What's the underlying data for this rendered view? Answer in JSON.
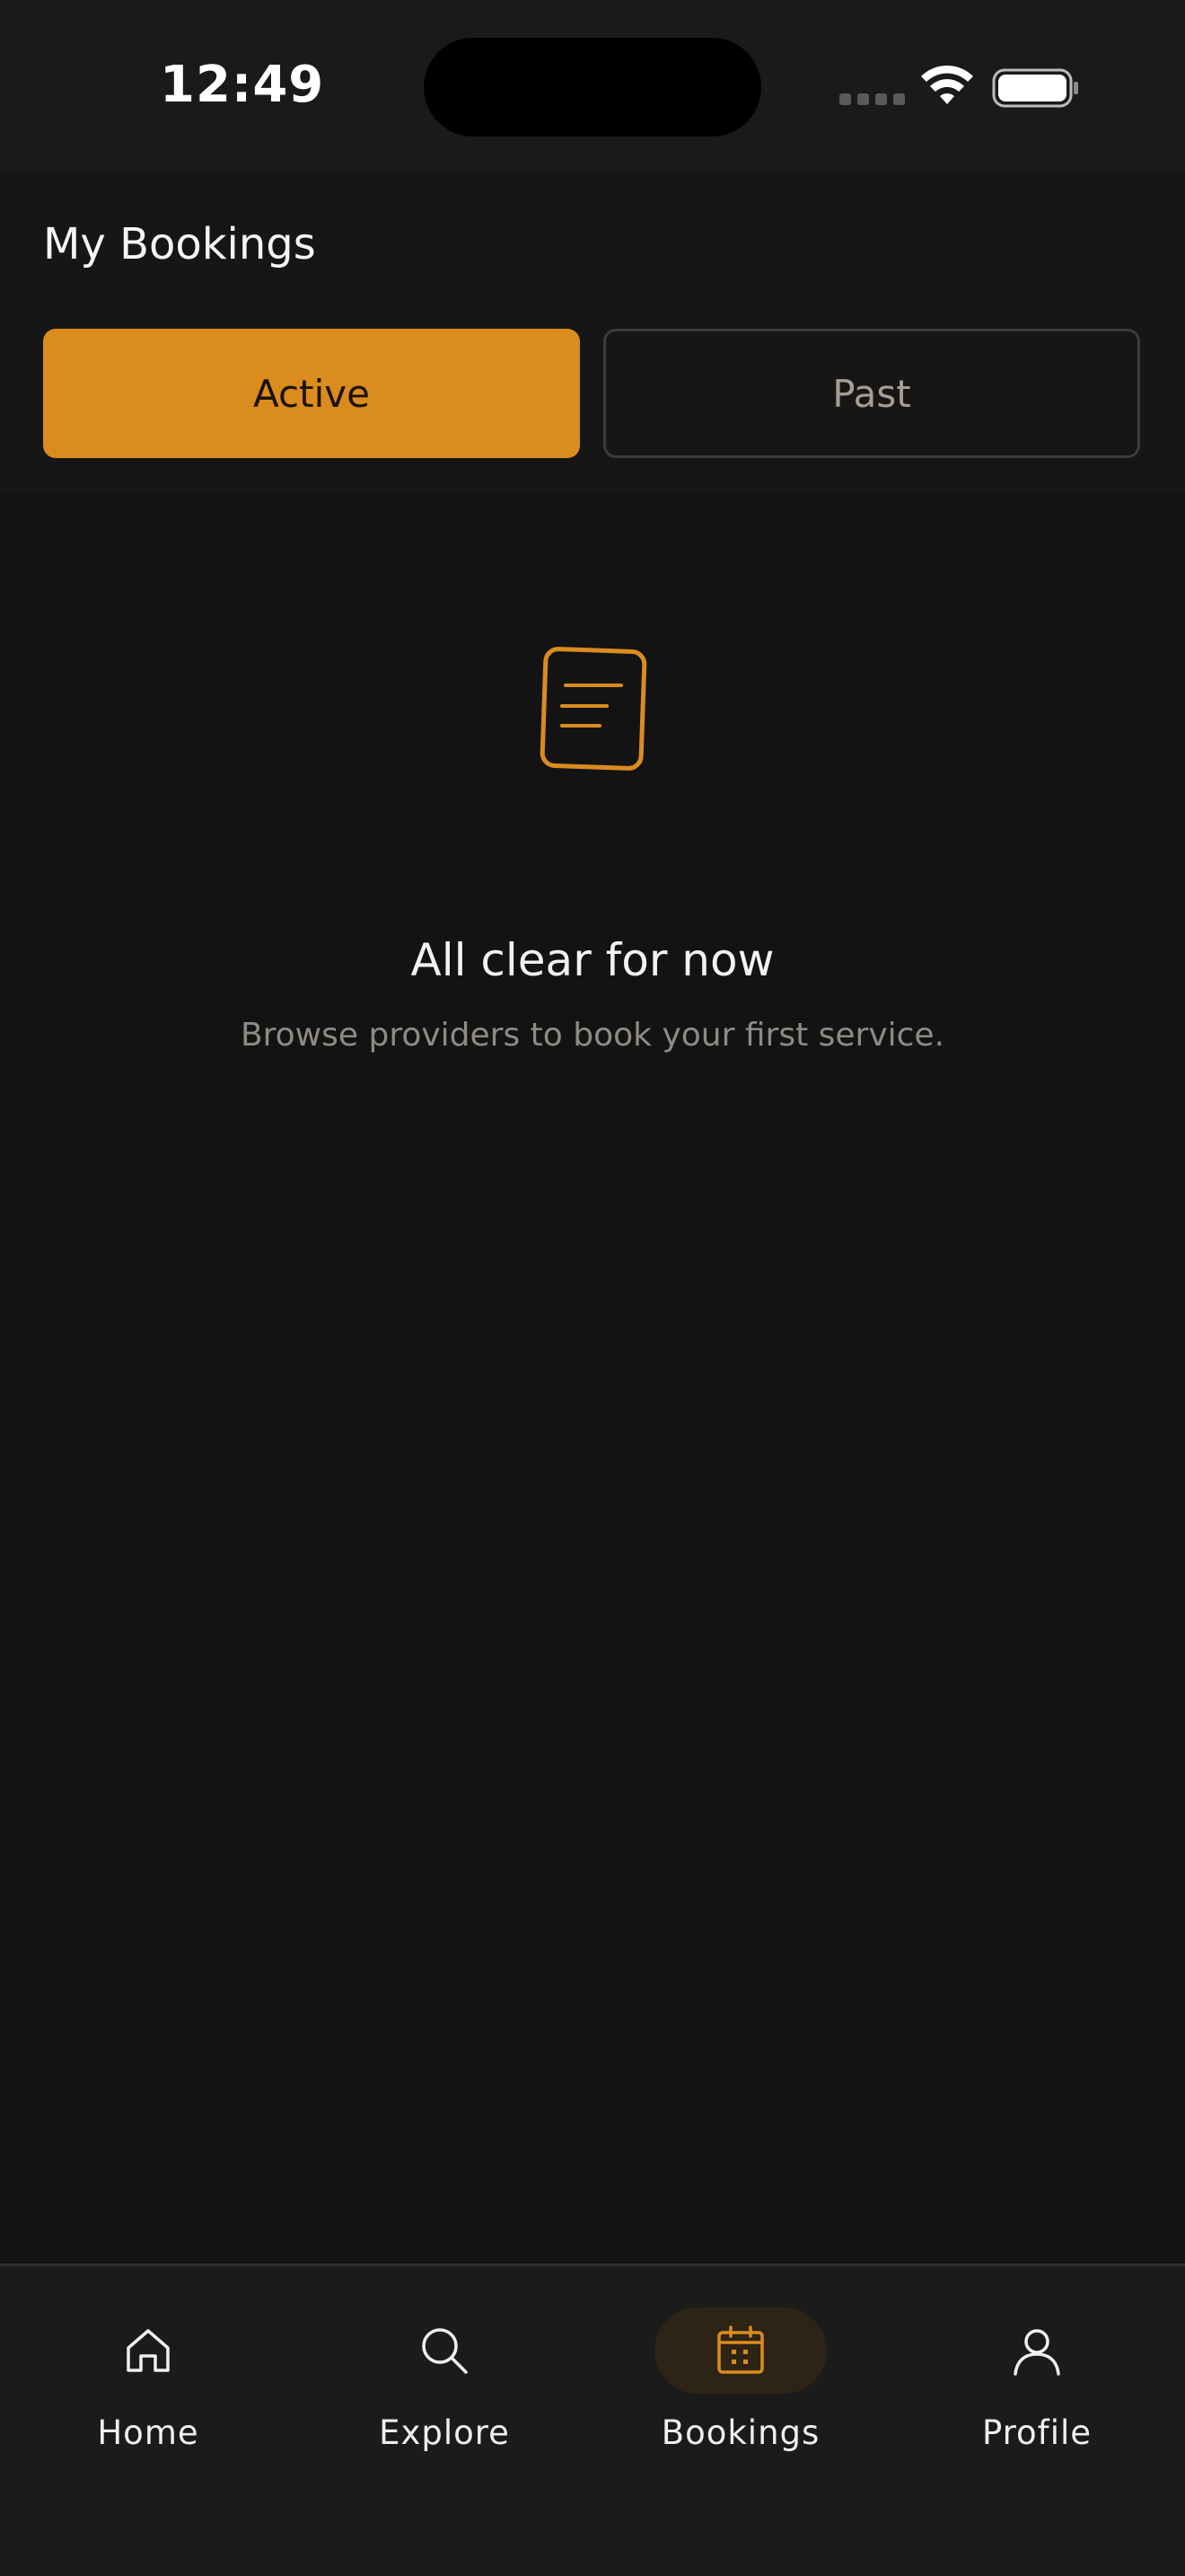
{
  "status_bar": {
    "time": "12:49"
  },
  "page": {
    "title": "My Bookings"
  },
  "tabs": [
    {
      "label": "Active",
      "selected": true
    },
    {
      "label": "Past",
      "selected": false
    }
  ],
  "empty_state": {
    "icon": "document-icon",
    "title": "All clear for now",
    "subtitle": "Browse providers to book your first service."
  },
  "bottom_nav": {
    "items": [
      {
        "label": "Home",
        "icon": "home-icon",
        "active": false
      },
      {
        "label": "Explore",
        "icon": "search-icon",
        "active": false
      },
      {
        "label": "Bookings",
        "icon": "calendar-icon",
        "active": true
      },
      {
        "label": "Profile",
        "icon": "user-icon",
        "active": false
      }
    ]
  },
  "colors": {
    "background": "#131313",
    "accent": "#db8c1e",
    "nav_background": "#1b1b1b",
    "text_primary": "#f2f2f2",
    "text_muted": "#8f8a83"
  }
}
